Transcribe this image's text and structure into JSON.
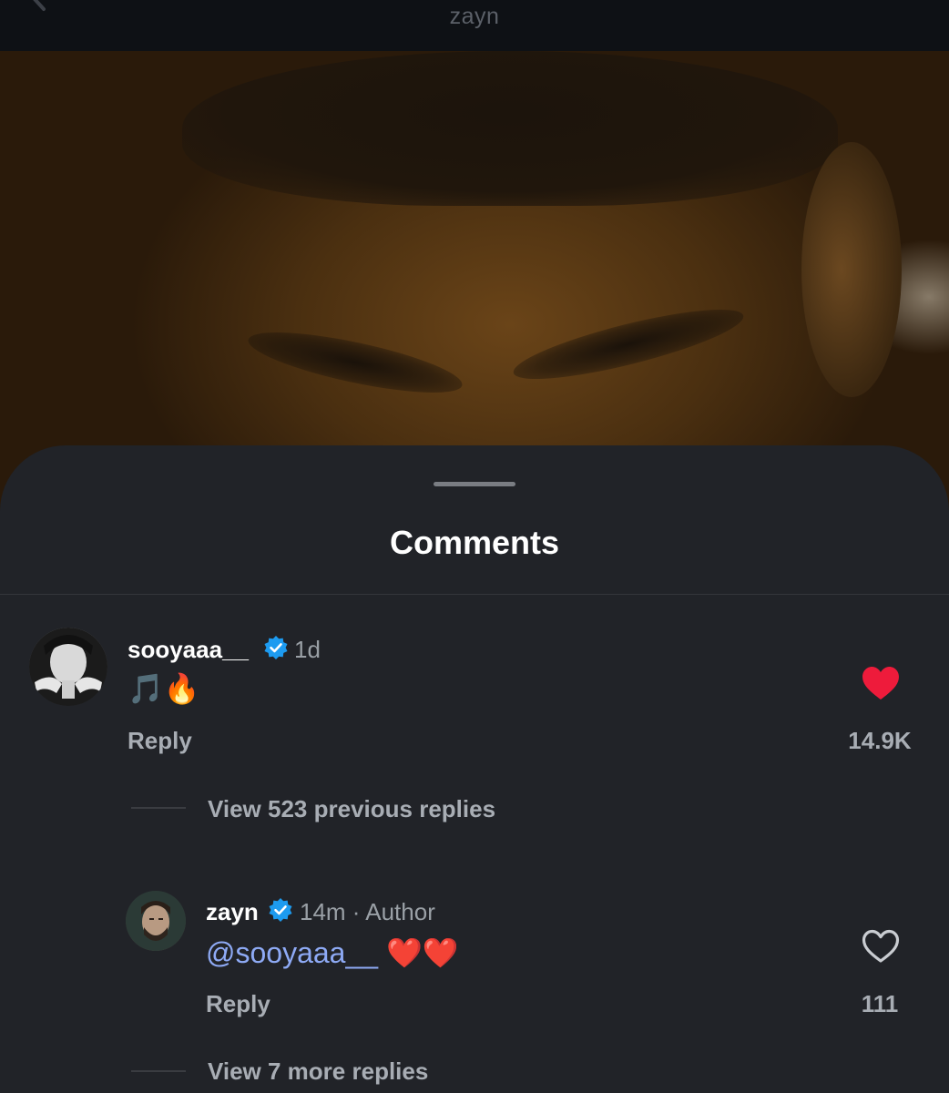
{
  "topbar": {
    "title": "zayn"
  },
  "sheet": {
    "title": "Comments"
  },
  "comments": [
    {
      "username": "sooyaaa__",
      "time": "1d",
      "text": "🎵🔥",
      "reply_label": "Reply",
      "likes": "14.9K",
      "liked": true,
      "view_replies": "View 523 previous replies"
    },
    {
      "username": "zayn",
      "time": "14m · Author",
      "mention": "@sooyaaa__",
      "text_after": "❤️❤️",
      "reply_label": "Reply",
      "likes": "111",
      "liked": false,
      "view_replies": "View 7 more replies"
    }
  ],
  "colors": {
    "sheet_bg": "#212328",
    "mention": "#8eaaf5",
    "like_red": "#ee1b3b",
    "verified_blue": "#1d9bf0"
  }
}
